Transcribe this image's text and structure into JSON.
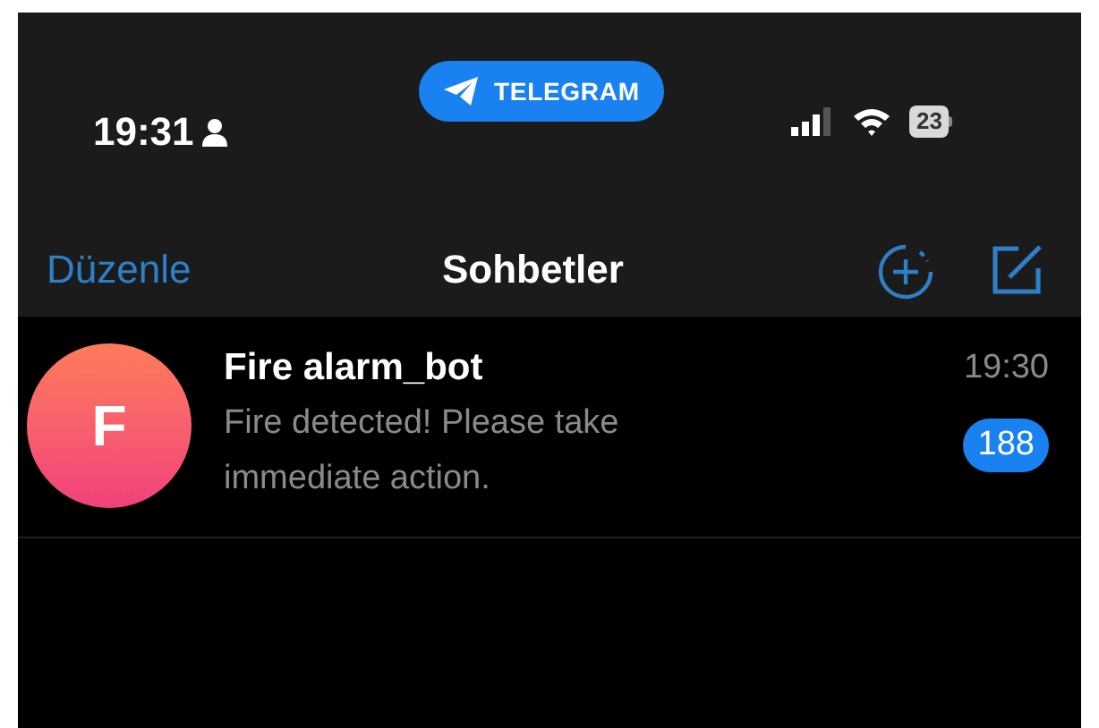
{
  "status_bar": {
    "time": "19:31",
    "app_pill": "TELEGRAM",
    "battery": "23"
  },
  "nav_bar": {
    "edit_button": "Düzenle",
    "title": "Sohbetler"
  },
  "chats": [
    {
      "avatar_letter": "F",
      "name": "Fire alarm_bot",
      "message": "Fire detected! Please take immediate action.",
      "time": "19:30",
      "unread_count": "188"
    }
  ]
}
